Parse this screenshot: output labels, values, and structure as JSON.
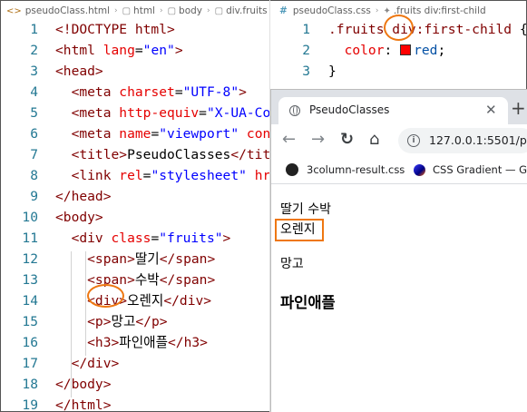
{
  "left_editor": {
    "breadcrumb": [
      "pseudoClass.html",
      "html",
      "body",
      "div.fruits"
    ],
    "lines": [
      {
        "n": "1",
        "tokens": [
          {
            "t": "<!DOCTYPE html>",
            "c": "tag"
          }
        ]
      },
      {
        "n": "2",
        "tokens": [
          {
            "t": "<html ",
            "c": "tag"
          },
          {
            "t": "lang",
            "c": "attr"
          },
          {
            "t": "=",
            "c": "txt"
          },
          {
            "t": "\"en\"",
            "c": "val"
          },
          {
            "t": ">",
            "c": "tag"
          }
        ]
      },
      {
        "n": "3",
        "tokens": [
          {
            "t": "<head>",
            "c": "tag"
          }
        ]
      },
      {
        "n": "4",
        "tokens": [
          {
            "t": "  <meta ",
            "c": "tag"
          },
          {
            "t": "charset",
            "c": "attr"
          },
          {
            "t": "=",
            "c": "txt"
          },
          {
            "t": "\"UTF-8\"",
            "c": "val"
          },
          {
            "t": ">",
            "c": "tag"
          }
        ]
      },
      {
        "n": "5",
        "tokens": [
          {
            "t": "  <meta ",
            "c": "tag"
          },
          {
            "t": "http-equiv",
            "c": "attr"
          },
          {
            "t": "=",
            "c": "txt"
          },
          {
            "t": "\"X-UA-Com",
            "c": "val"
          }
        ]
      },
      {
        "n": "6",
        "tokens": [
          {
            "t": "  <meta ",
            "c": "tag"
          },
          {
            "t": "name",
            "c": "attr"
          },
          {
            "t": "=",
            "c": "txt"
          },
          {
            "t": "\"viewport\"",
            "c": "val"
          },
          {
            "t": " ",
            "c": "txt"
          },
          {
            "t": "cont",
            "c": "attr"
          }
        ]
      },
      {
        "n": "7",
        "tokens": [
          {
            "t": "  <title>",
            "c": "tag"
          },
          {
            "t": "PseudoClasses",
            "c": "txt"
          },
          {
            "t": "</titl",
            "c": "tag"
          }
        ]
      },
      {
        "n": "8",
        "tokens": [
          {
            "t": "  <link ",
            "c": "tag"
          },
          {
            "t": "rel",
            "c": "attr"
          },
          {
            "t": "=",
            "c": "txt"
          },
          {
            "t": "\"stylesheet\"",
            "c": "val"
          },
          {
            "t": " ",
            "c": "txt"
          },
          {
            "t": "hre",
            "c": "attr"
          }
        ]
      },
      {
        "n": "9",
        "tokens": [
          {
            "t": "</head>",
            "c": "tag"
          }
        ]
      },
      {
        "n": "10",
        "tokens": [
          {
            "t": "<body>",
            "c": "tag"
          }
        ]
      },
      {
        "n": "11",
        "tokens": [
          {
            "t": "  <div ",
            "c": "tag"
          },
          {
            "t": "class",
            "c": "attr"
          },
          {
            "t": "=",
            "c": "txt"
          },
          {
            "t": "\"fruits\"",
            "c": "val"
          },
          {
            "t": ">",
            "c": "tag"
          }
        ]
      },
      {
        "n": "12",
        "tokens": [
          {
            "t": "    <span>",
            "c": "tag"
          },
          {
            "t": "딸기",
            "c": "txt"
          },
          {
            "t": "</span>",
            "c": "tag"
          }
        ]
      },
      {
        "n": "13",
        "tokens": [
          {
            "t": "    <span>",
            "c": "tag"
          },
          {
            "t": "수박",
            "c": "txt"
          },
          {
            "t": "</span>",
            "c": "tag"
          }
        ]
      },
      {
        "n": "14",
        "tokens": [
          {
            "t": "    <div>",
            "c": "tag"
          },
          {
            "t": "오렌지",
            "c": "txt"
          },
          {
            "t": "</div>",
            "c": "tag"
          }
        ]
      },
      {
        "n": "15",
        "tokens": [
          {
            "t": "    <p>",
            "c": "tag"
          },
          {
            "t": "망고",
            "c": "txt"
          },
          {
            "t": "</p>",
            "c": "tag"
          }
        ]
      },
      {
        "n": "16",
        "tokens": [
          {
            "t": "    <h3>",
            "c": "tag"
          },
          {
            "t": "파인애플",
            "c": "txt"
          },
          {
            "t": "</h3>",
            "c": "tag"
          }
        ]
      },
      {
        "n": "17",
        "tokens": [
          {
            "t": "  </div>",
            "c": "tag"
          }
        ]
      },
      {
        "n": "18",
        "tokens": [
          {
            "t": "</body>",
            "c": "tag"
          }
        ]
      },
      {
        "n": "19",
        "tokens": [
          {
            "t": "</html>",
            "c": "tag"
          }
        ]
      }
    ]
  },
  "right_editor": {
    "breadcrumb_file": "pseudoClass.css",
    "breadcrumb_rule": ".fruits div:first-child",
    "lines": [
      {
        "n": "1",
        "tokens": [
          {
            "t": ".fruits div",
            "c": "sel"
          },
          {
            "t": ":first-child",
            "c": "sel"
          },
          {
            "t": " {",
            "c": "txt"
          }
        ]
      },
      {
        "n": "2",
        "tokens": [
          {
            "t": "  color",
            "c": "prop"
          },
          {
            "t": ": ",
            "c": "txt"
          },
          {
            "t": "SWATCH",
            "c": "swatch"
          },
          {
            "t": "red",
            "c": "cssval"
          },
          {
            "t": ";",
            "c": "txt"
          }
        ]
      },
      {
        "n": "3",
        "tokens": [
          {
            "t": "}",
            "c": "txt"
          }
        ]
      }
    ],
    "swatch_color": "#ff0000"
  },
  "browser": {
    "tab_title": "PseudoClasses",
    "close_glyph": "✕",
    "new_tab_glyph": "+",
    "back_glyph": "←",
    "forward_glyph": "→",
    "reload_glyph": "↻",
    "home_glyph": "⌂",
    "info_glyph": "i",
    "url": "127.0.0.1:5501/ps",
    "bookmarks": [
      "3column-result.css",
      "CSS Gradient — G"
    ],
    "content": {
      "spans": "딸기 수박",
      "div": "오렌지",
      "p": "망고",
      "h3": "파인애플"
    }
  },
  "colors": {
    "annotation": "#ee7711",
    "line_number": "#237893",
    "tag": "#800000",
    "attr": "#e50000",
    "value": "#0000ff"
  }
}
